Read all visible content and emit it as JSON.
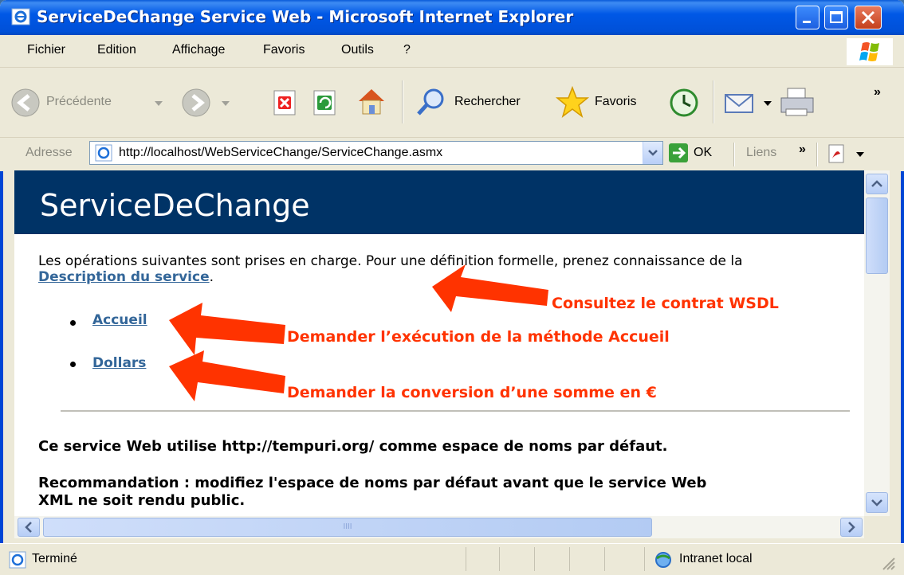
{
  "window": {
    "title": "ServiceDeChange Service Web - Microsoft Internet Explorer"
  },
  "menubar": {
    "items": [
      "Fichier",
      "Edition",
      "Affichage",
      "Favoris",
      "Outils",
      "?"
    ]
  },
  "toolbar": {
    "back_label": "Précédente",
    "search_label": "Rechercher",
    "favorites_label": "Favoris",
    "more_glyph": "»"
  },
  "addressbar": {
    "label": "Adresse",
    "url": "http://localhost/WebServiceChange/ServiceChange.asmx",
    "go_label": "OK",
    "links_label": "Liens",
    "links_glyph": "»"
  },
  "page": {
    "heading": "ServiceDeChange",
    "intro_text": "Les opérations suivantes sont prises en charge. Pour une définition formelle, prenez connaissance de la ",
    "description_link": "Description du service",
    "intro_end": ".",
    "operations": [
      "Accueil",
      "Dollars"
    ],
    "namespace_text": "Ce service Web utilise http://tempuri.org/ comme espace de noms par défaut.",
    "recommendation_line1": "Recommandation : modifiez l'espace de noms par défaut avant que le service Web",
    "recommendation_line2": "XML ne soit rendu public."
  },
  "annotations": {
    "wsdl": "Consultez le contrat WSDL",
    "accueil": "Demander l’exécution de la méthode Accueil",
    "dollars": "Demander la conversion d’une somme en €",
    "color": "#ff3300"
  },
  "scrollbar": {
    "hthumb_grip": "IIII"
  },
  "statusbar": {
    "status": "Terminé",
    "zone": "Intranet local"
  },
  "colors": {
    "titlebar": "#0058e6",
    "heading_band": "#003366",
    "link": "#336699",
    "chrome": "#ece9d8"
  }
}
